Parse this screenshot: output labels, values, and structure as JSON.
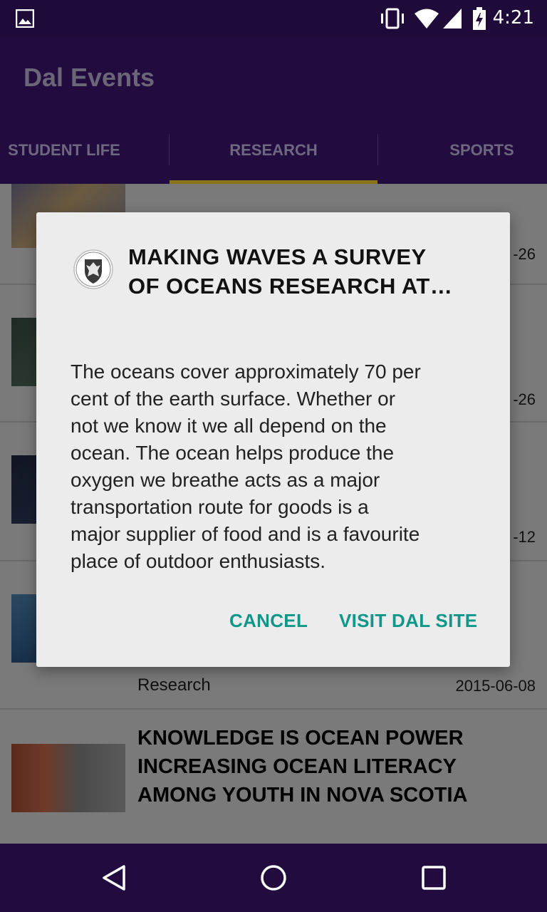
{
  "status": {
    "time": "4:21"
  },
  "app": {
    "title": "Dal Events"
  },
  "tabs": [
    {
      "label": "STUDENT LIFE"
    },
    {
      "label": "RESEARCH"
    },
    {
      "label": "SPORTS"
    }
  ],
  "list": {
    "rows": [
      {
        "date": "-26"
      },
      {
        "date": "-26"
      },
      {
        "date": "-12"
      },
      {
        "category": "Research",
        "date": "2015-06-08"
      },
      {
        "title_line1": "KNOWLEDGE IS OCEAN POWER",
        "title_line2": "INCREASING OCEAN LITERACY",
        "title_line3": "AMONG YOUTH IN NOVA SCOTIA"
      }
    ]
  },
  "dialog": {
    "title_line1": "MAKING WAVES A SURVEY",
    "title_line2": "OF OCEANS RESEARCH AT…",
    "body_line1": "The oceans cover approximately 70 per",
    "body_line2": "cent of the earth surface. Whether or",
    "body_line3": "not we know it we all depend on the",
    "body_line4": "ocean. The ocean helps produce the",
    "body_line5": "oxygen we breathe acts as a major",
    "body_line6": "transportation route for goods is a",
    "body_line7": "major supplier of food and is a favourite",
    "body_line8": "place of outdoor enthusiasts.",
    "cancel_label": "CANCEL",
    "visit_label": "VISIT DAL SITE"
  },
  "colors": {
    "primary": "#220c3f",
    "tab_indicator": "#8a7418",
    "dialog_button": "#11968a"
  },
  "icons": [
    "image-notification-icon",
    "vibrate-icon",
    "wifi-icon",
    "signal-icon",
    "battery-icon",
    "dal-crest-icon",
    "back-icon",
    "home-icon",
    "recents-icon"
  ]
}
